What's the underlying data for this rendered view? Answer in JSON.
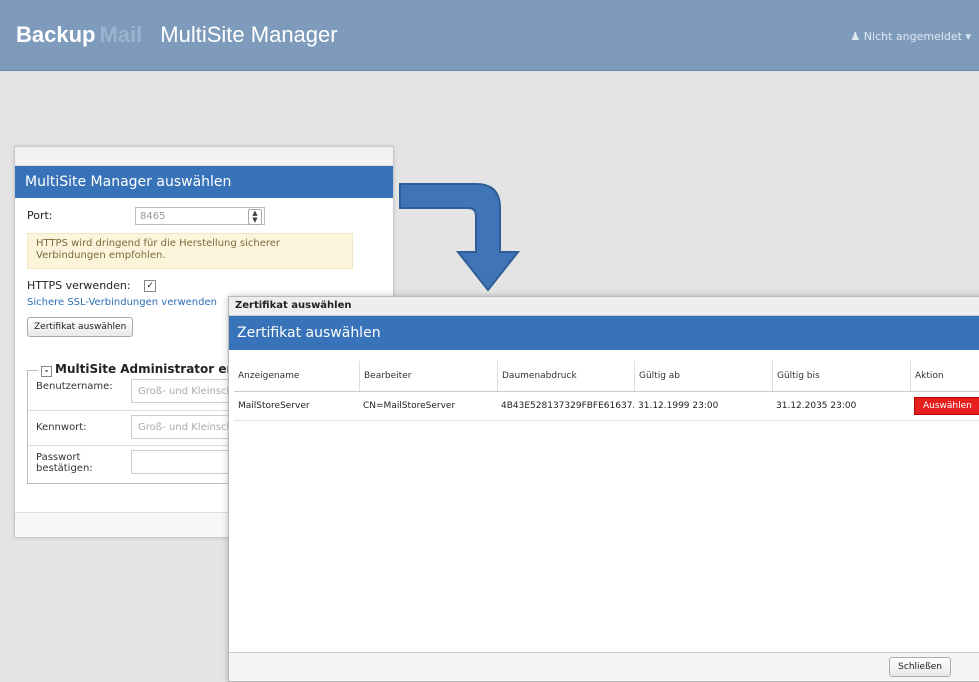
{
  "navbar": {
    "brand_1": "Backup",
    "brand_2": "Mail",
    "brand_3": "MultiSite Manager",
    "user_icon": "user-icon",
    "user_label": "Nicht angemeldet",
    "caret": "▾"
  },
  "panel": {
    "title": "MultiSite Manager auswählen",
    "port_label": "Port:",
    "port_value": "8465",
    "warning": "HTTPS wird dringend für die Herstellung sicherer Verbindungen empfohlen.",
    "https_label": "HTTPS verwenden:",
    "https_checked": "✓",
    "ssl_link": "Sichere SSL-Verbindungen verwenden",
    "cert_button": "Zertifikat auswählen",
    "admin_section": "MultiSite Administrator erstellen",
    "username_label": "Benutzername:",
    "username_placeholder": "Groß- und Kleinschreibung",
    "password_label": "Kennwort:",
    "password_placeholder": "Groß- und Kleinschreibung",
    "confirm_label_1": "Passwort",
    "confirm_label_2": "bestätigen:"
  },
  "dialog": {
    "window_title": "Zertifikat auswählen",
    "header": "Zertifikat auswählen",
    "columns": [
      "Anzeigename",
      "Bearbeiter",
      "Daumenabdruck",
      "Gültig ab",
      "Gültig bis",
      "Aktion"
    ],
    "rows": [
      {
        "name": "MailStoreServer",
        "issuer": "CN=MailStoreServer",
        "thumbprint": "4B43E528137329FBFE61637...",
        "valid_from": "31.12.1999 23:00",
        "valid_to": "31.12.2035 23:00",
        "action": "Auswählen"
      }
    ],
    "close_button": "Schließen"
  },
  "colors": {
    "navbar": "#7f9bbb",
    "header_blue": "#3873b9",
    "action_red": "#e61e1e"
  }
}
